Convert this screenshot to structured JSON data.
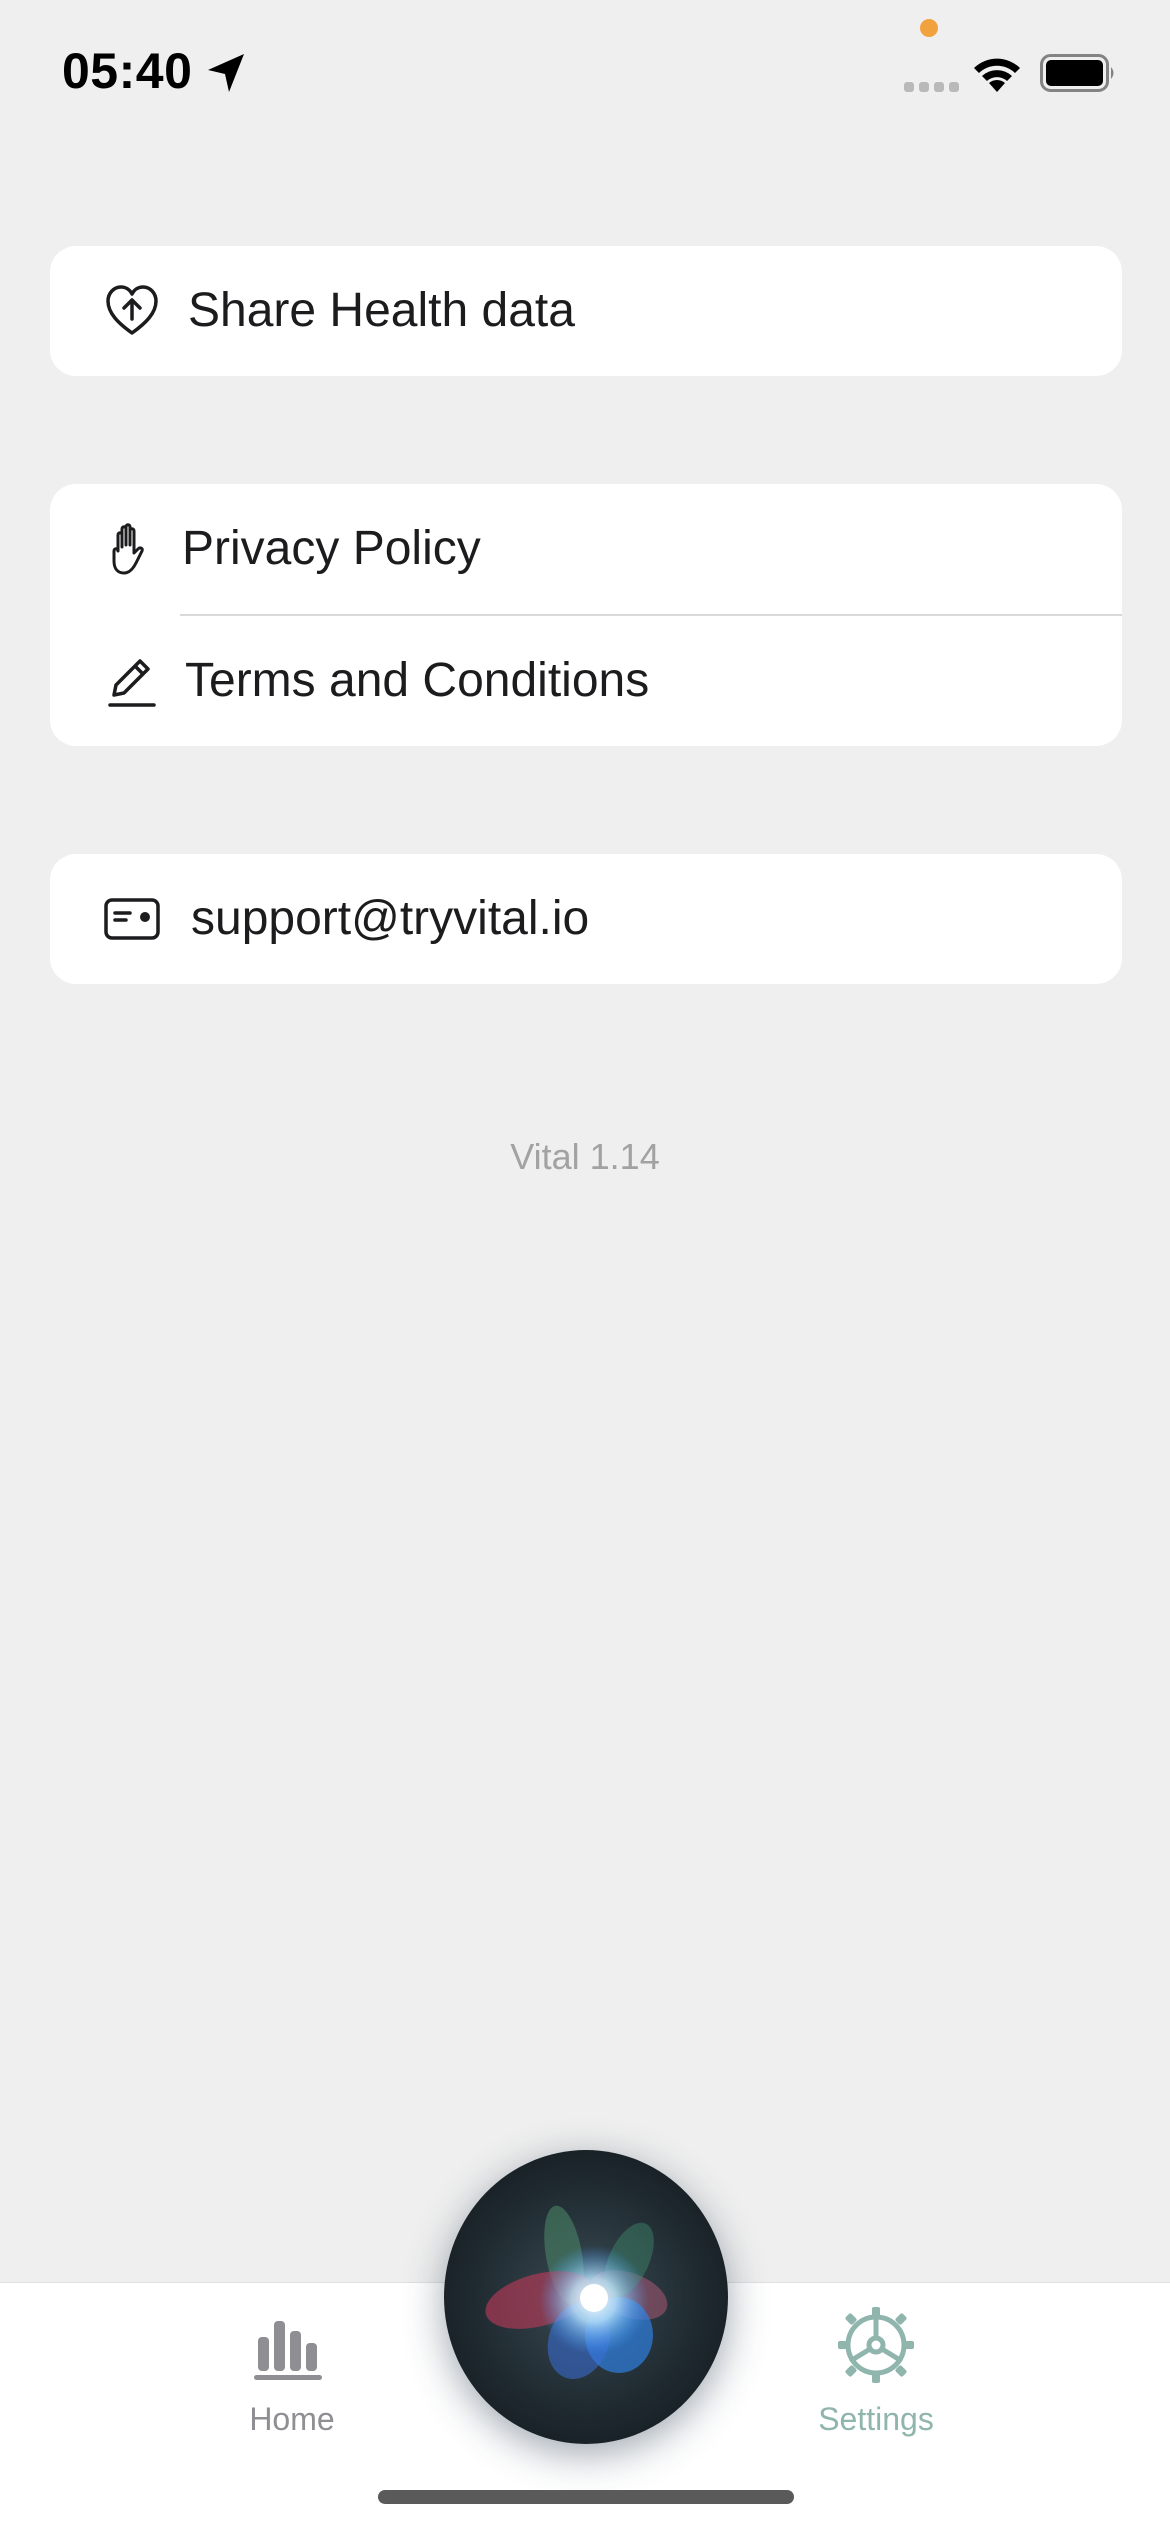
{
  "status_bar": {
    "time": "05:40"
  },
  "health_section": {
    "share_label": "Share Health data",
    "icon": "heart-upload-icon"
  },
  "legal_section": {
    "items": [
      {
        "label": "Privacy Policy",
        "icon": "hand-icon"
      },
      {
        "label": "Terms and Conditions",
        "icon": "pencil-icon"
      }
    ]
  },
  "support_section": {
    "email": "support@tryvital.io",
    "icon": "id-card-icon"
  },
  "footer": {
    "version": "Vital 1.14"
  },
  "tab_bar": {
    "tabs": [
      {
        "label": "Home",
        "icon": "bar-chart-icon",
        "selected": false
      },
      {
        "label": "Settings",
        "icon": "gear-icon",
        "selected": true
      }
    ],
    "accent_color": "#8fb5ad"
  },
  "colors": {
    "background": "#efefef",
    "card": "#ffffff",
    "status_dot": "#f2a23c"
  }
}
